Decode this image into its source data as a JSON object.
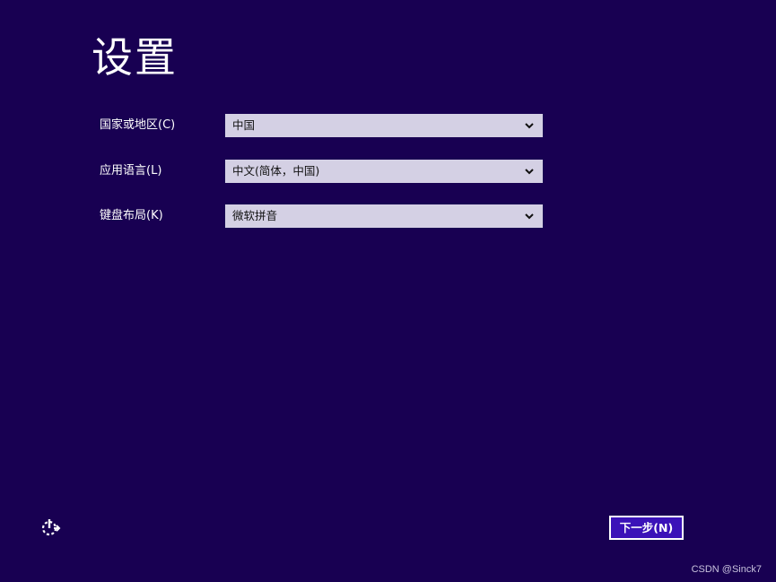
{
  "page": {
    "title": "设置",
    "background": "#180052"
  },
  "form": {
    "rows": [
      {
        "label": "国家或地区(C)",
        "value": "中国"
      },
      {
        "label": "应用语言(L)",
        "value": "中文(简体，中国)"
      },
      {
        "label": "键盘布局(K)",
        "value": "微软拼音"
      }
    ],
    "dropdown_icon": "chevron-down-icon"
  },
  "footer": {
    "settings_icon": "ease-of-access-icon",
    "next_label": "下一步(N)",
    "watermark": "CSDN @Sinck7"
  }
}
